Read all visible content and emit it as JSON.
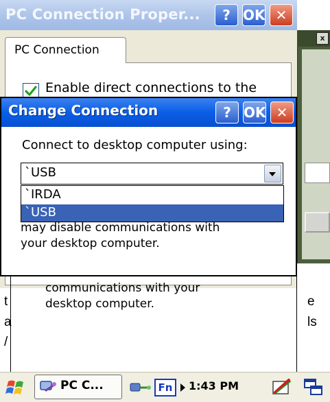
{
  "properties_window": {
    "title": "PC Connection Proper...",
    "help_label": "?",
    "ok_label": "OK",
    "close_label": "✕",
    "tab_label": "PC Connection",
    "checkbox_checked": true,
    "checkbox_label": "Enable direct connections to the",
    "info_lines": [
      "communications with your",
      "desktop computer."
    ]
  },
  "change_connection_dialog": {
    "title": "Change Connection",
    "help_label": "?",
    "ok_label": "OK",
    "close_label": "✕",
    "prompt": "Connect to desktop computer using:",
    "selected_value": "`USB",
    "options": [
      {
        "label": "`IRDA",
        "selected": false
      },
      {
        "label": "`USB",
        "selected": true
      }
    ],
    "warning_lines": [
      "may disable communications with",
      "your desktop computer."
    ]
  },
  "background_fragments": {
    "left_t": "t",
    "left_a": "a",
    "left_slash": "/",
    "right_e": "e",
    "right_ls": "ls"
  },
  "background_window": {
    "close_label": "x"
  },
  "taskbar": {
    "start_icon": "windows-flag-icon",
    "task_label": "PC C...",
    "fn_label": "Fn",
    "time": "1:43 PM",
    "colors": {
      "task_bar": "#f1efe2",
      "dialog_title": "#0a5ee6",
      "selection": "#3a62b5"
    }
  }
}
